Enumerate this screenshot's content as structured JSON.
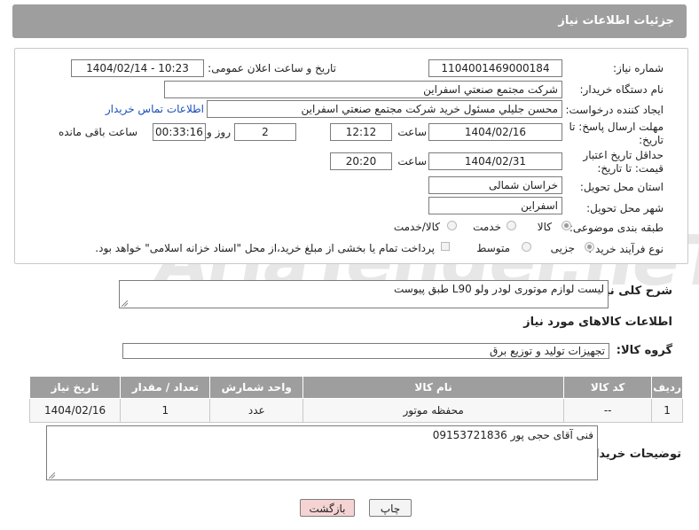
{
  "header": {
    "title": "جزئیات اطلاعات نیاز"
  },
  "fields": {
    "need_number_label": "شماره نیاز:",
    "need_number": "1104001469000184",
    "announce_label": "تاریخ و ساعت اعلان عمومی:",
    "announce_value": "1404/02/14 - 10:23",
    "buyer_org_label": "نام دستگاه خریدار:",
    "buyer_org": "شرکت مجتمع صنعتي اسفراين",
    "creator_label": "ایجاد کننده درخواست:",
    "creator": "محسن جليلي مسئول خريد شركت مجتمع صنعتي اسفراين",
    "contact_link": "اطلاعات تماس خریدار",
    "deadline_label": "مهلت ارسال پاسخ: تا تاریخ:",
    "deadline_date": "1404/02/16",
    "hour_label": "ساعت",
    "deadline_time": "12:12",
    "days_value": "2",
    "days_label": "روز و",
    "remaining_time": "00:33:16",
    "remaining_label": "ساعت باقی مانده",
    "price_label": "حداقل تاریخ اعتبار قیمت: تا تاریخ:",
    "price_date": "1404/02/31",
    "price_time": "20:20",
    "province_label": "استان محل تحویل:",
    "province": "خراسان شمالی",
    "city_label": "شهر محل تحویل:",
    "city": "اسفراين",
    "category_label": "طبقه بندی موضوعی:",
    "category_options": [
      "کالا",
      "خدمت",
      "کالا/خدمت"
    ],
    "process_label": "نوع فرآیند خرید :",
    "process_options": [
      "جزیی",
      "متوسط"
    ],
    "payment_note": "پرداخت تمام یا بخشی از مبلغ خرید،از محل \"اسناد خزانه اسلامی\" خواهد بود."
  },
  "description": {
    "label": "شرح کلی نیاز:",
    "value": "لیست لوازم موتوری لودر ولو L90 طبق پیوست"
  },
  "goods": {
    "section_title": "اطلاعات کالاهای مورد نیاز",
    "group_label": "گروه کالا:",
    "group_value": "تجهیزات تولید و توزیع برق",
    "columns": [
      "ردیف",
      "کد کالا",
      "نام کالا",
      "واحد شمارش",
      "تعداد / مقدار",
      "تاریخ نیاز"
    ],
    "rows": [
      [
        "1",
        "--",
        "محفظه موتور",
        "عدد",
        "1",
        "1404/02/16"
      ]
    ]
  },
  "buyer_notes": {
    "label": "توضیحات خریدار:",
    "value": "فنی آقای حجی پور 09153721836"
  },
  "buttons": {
    "print": "چاپ",
    "back": "بازگشت"
  },
  "watermark": {
    "text": "AriaTender.neT"
  },
  "colors": {
    "header_bg": "#9e9e9e",
    "link": "#1a4fb8",
    "back_button_bg": "#f6d3d3"
  }
}
